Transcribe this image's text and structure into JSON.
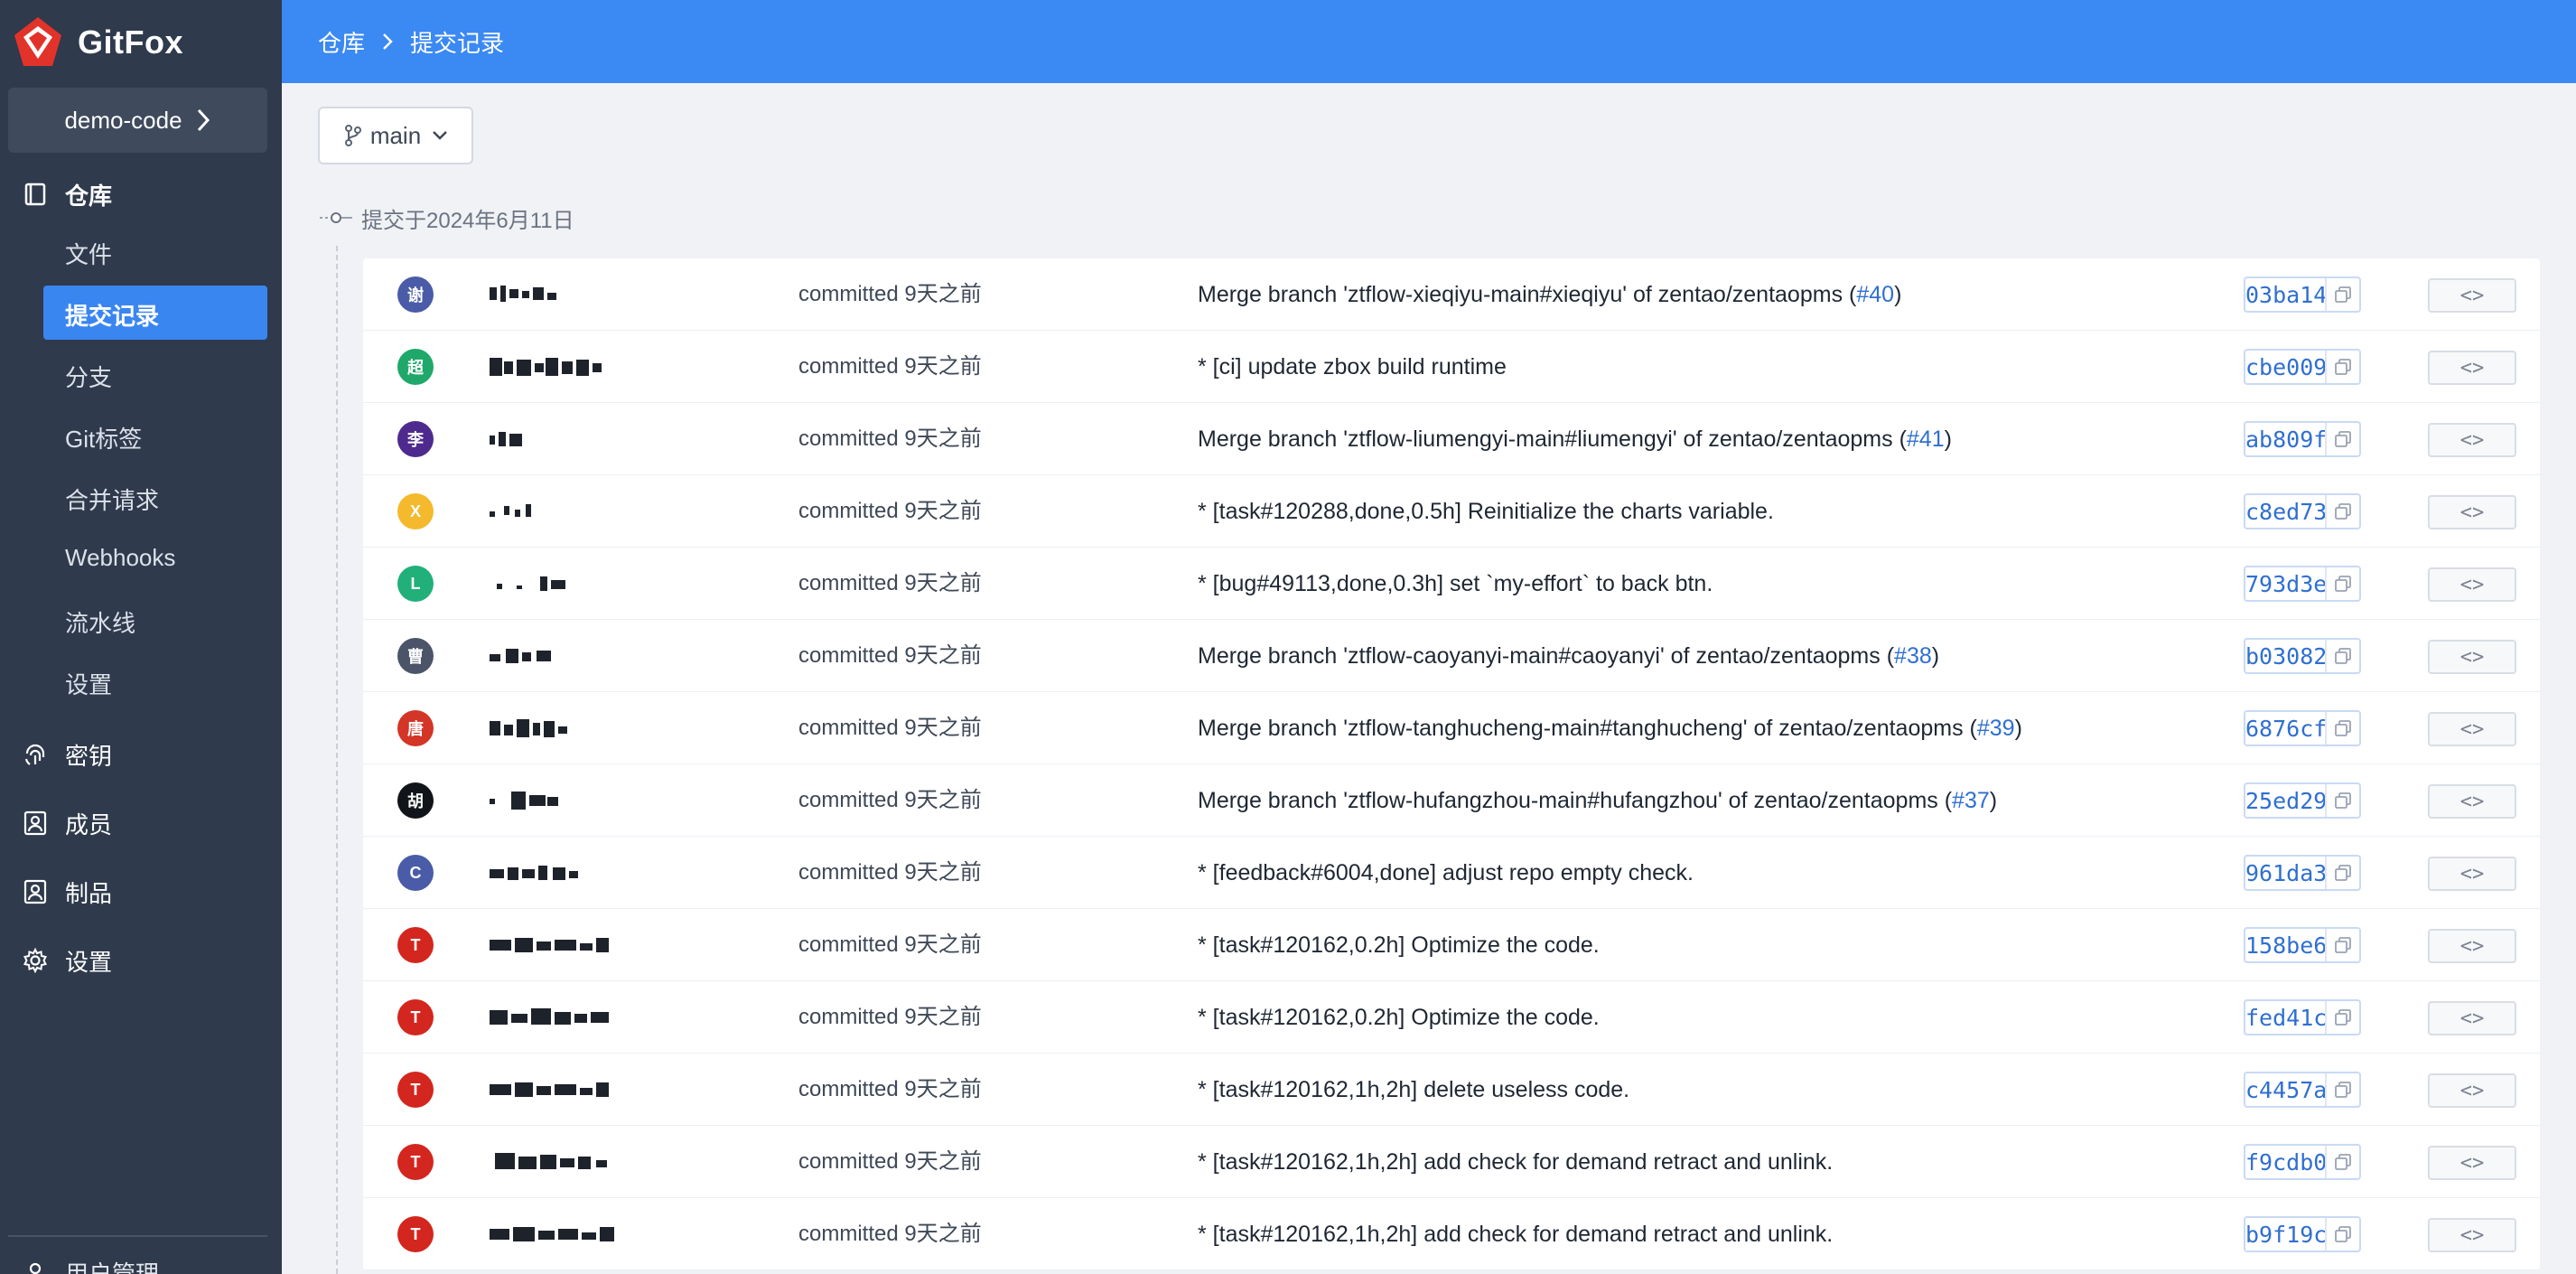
{
  "app": {
    "name": "GitFox"
  },
  "project": {
    "name": "demo-code"
  },
  "sidebar": {
    "repo_group": "仓库",
    "repo_items": [
      "文件",
      "提交记录",
      "分支",
      "Git标签",
      "合并请求",
      "Webhooks",
      "流水线",
      "设置"
    ],
    "main_items": [
      {
        "label": "密钥",
        "icon": "fingerprint-icon"
      },
      {
        "label": "成员",
        "icon": "member-icon"
      },
      {
        "label": "制品",
        "icon": "artifact-icon"
      },
      {
        "label": "设置",
        "icon": "gear-icon"
      }
    ],
    "bottom_label": "用户管理"
  },
  "breadcrumb": {
    "root": "仓库",
    "current": "提交记录"
  },
  "branch": {
    "name": "main"
  },
  "timeline": {
    "date_label": "提交于2024年6月11日"
  },
  "colors": {
    "accent": "#3b89f2",
    "sidebar_bg": "#2f3a4c",
    "link": "#2f6fd1"
  },
  "commits": [
    {
      "avatar": "谢",
      "avatar_color": "#4a5ba8",
      "committed": "committed 9天之前",
      "message": "Merge branch 'ztflow-xieqiyu-main#xieqiyu' of zentao/zentaopms (",
      "pr": "#40",
      "suffix": ")",
      "sha": "03ba14",
      "browse": "<>"
    },
    {
      "avatar": "超",
      "avatar_color": "#1fa86a",
      "committed": "committed 9天之前",
      "message": "* [ci] update zbox build runtime",
      "pr": "",
      "suffix": "",
      "sha": "cbe009",
      "browse": "<>"
    },
    {
      "avatar": "李",
      "avatar_color": "#4e2a8e",
      "committed": "committed 9天之前",
      "message": "Merge branch 'ztflow-liumengyi-main#liumengyi' of zentao/zentaopms (",
      "pr": "#41",
      "suffix": ")",
      "sha": "ab809f",
      "browse": "<>"
    },
    {
      "avatar": "X",
      "avatar_color": "#f4b92c",
      "committed": "committed 9天之前",
      "message": "* [task#120288,done,0.5h] Reinitialize the charts variable.",
      "pr": "",
      "suffix": "",
      "sha": "c8ed73",
      "browse": "<>"
    },
    {
      "avatar": "L",
      "avatar_color": "#22b07a",
      "committed": "committed 9天之前",
      "message": "* [bug#49113,done,0.3h] set `my-effort` to back btn.",
      "pr": "",
      "suffix": "",
      "sha": "793d3e",
      "browse": "<>"
    },
    {
      "avatar": "曹",
      "avatar_color": "#4b5468",
      "committed": "committed 9天之前",
      "message": "Merge branch 'ztflow-caoyanyi-main#caoyanyi' of zentao/zentaopms (",
      "pr": "#38",
      "suffix": ")",
      "sha": "b03082",
      "browse": "<>"
    },
    {
      "avatar": "唐",
      "avatar_color": "#d33526",
      "committed": "committed 9天之前",
      "message": "Merge branch 'ztflow-tanghucheng-main#tanghucheng' of zentao/zentaopms (",
      "pr": "#39",
      "suffix": ")",
      "sha": "6876cf",
      "browse": "<>"
    },
    {
      "avatar": "胡",
      "avatar_color": "#111418",
      "committed": "committed 9天之前",
      "message": "Merge branch 'ztflow-hufangzhou-main#hufangzhou' of zentao/zentaopms (",
      "pr": "#37",
      "suffix": ")",
      "sha": "25ed29",
      "browse": "<>"
    },
    {
      "avatar": "C",
      "avatar_color": "#4a5ba8",
      "committed": "committed 9天之前",
      "message": "* [feedback#6004,done] adjust repo empty check.",
      "pr": "",
      "suffix": "",
      "sha": "961da3",
      "browse": "<>"
    },
    {
      "avatar": "T",
      "avatar_color": "#d3261e",
      "committed": "committed 9天之前",
      "message": "* [task#120162,0.2h] Optimize the code.",
      "pr": "",
      "suffix": "",
      "sha": "158be6",
      "browse": "<>"
    },
    {
      "avatar": "T",
      "avatar_color": "#d3261e",
      "committed": "committed 9天之前",
      "message": "* [task#120162,0.2h] Optimize the code.",
      "pr": "",
      "suffix": "",
      "sha": "fed41c",
      "browse": "<>"
    },
    {
      "avatar": "T",
      "avatar_color": "#d3261e",
      "committed": "committed 9天之前",
      "message": "* [task#120162,1h,2h] delete useless code.",
      "pr": "",
      "suffix": "",
      "sha": "c4457a",
      "browse": "<>"
    },
    {
      "avatar": "T",
      "avatar_color": "#d3261e",
      "committed": "committed 9天之前",
      "message": "* [task#120162,1h,2h] add check for demand retract and unlink.",
      "pr": "",
      "suffix": "",
      "sha": "f9cdb0",
      "browse": "<>"
    },
    {
      "avatar": "T",
      "avatar_color": "#d3261e",
      "committed": "committed 9天之前",
      "message": "* [task#120162,1h,2h] add check for demand retract and unlink.",
      "pr": "",
      "suffix": "",
      "sha": "b9f19c",
      "browse": "<>"
    }
  ]
}
